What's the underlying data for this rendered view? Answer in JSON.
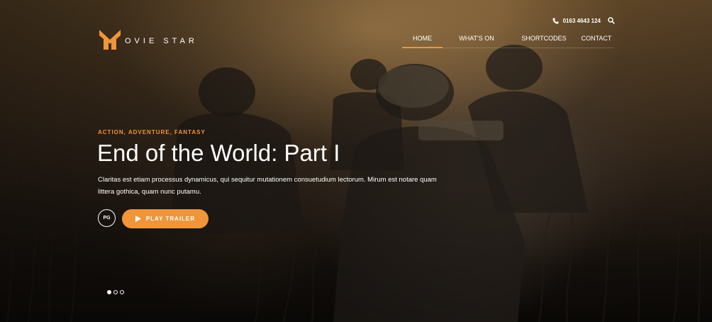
{
  "brand": {
    "logo_text": "OVIE STAR",
    "accent_color": "#f0953a"
  },
  "topbar": {
    "phone_icon": "phone-icon",
    "phone": "0163 4643 124",
    "search_icon": "search-icon"
  },
  "nav": {
    "items": [
      {
        "label": "HOME",
        "active": true
      },
      {
        "label": "WHAT'S ON",
        "active": false
      },
      {
        "label": "SHORTCODES",
        "active": false
      },
      {
        "label": "CONTACT",
        "active": false
      }
    ]
  },
  "hero": {
    "genres": "ACTION, ADVENTURE, FANTASY",
    "title": "End of the World: Part I",
    "description": "Claritas est etiam processus dynamicus, qui sequitur mutationem consuetudium lectorum. Mirum est notare quam littera gothica, quam nunc putamu.",
    "rating": "PG",
    "play_label": "PLAY TRAILER",
    "play_icon": "play-icon"
  },
  "slider": {
    "total": 3,
    "active_index": 0
  }
}
